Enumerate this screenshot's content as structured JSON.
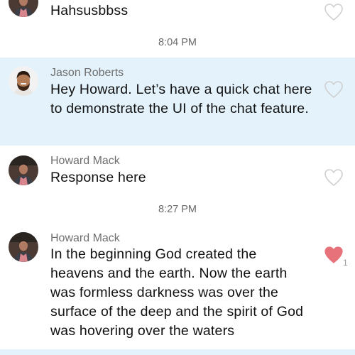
{
  "messages": [
    {
      "sender": "",
      "text": "Hahsusbbss",
      "liked": false,
      "avatar_icon": "howard-avatar",
      "highlighted": false
    },
    {
      "sender": "Jason Roberts",
      "text": "Hey Howard. Let’s have a quick chat here to demonstrate the UI of the chat feature.",
      "liked": false,
      "avatar_icon": "jason-avatar",
      "highlighted": true
    },
    {
      "sender": "Howard Mack",
      "text": "Response here",
      "liked": false,
      "avatar_icon": "howard-avatar",
      "highlighted": false
    },
    {
      "sender": "Howard Mack",
      "text": "In the beginning God created the heavens and the earth. Now the earth was formless darkness was over the surface of the deep and the spirit of God was hovering over the waters",
      "liked": true,
      "like_count": "1",
      "avatar_icon": "howard-avatar",
      "highlighted": false
    }
  ],
  "timestamps": [
    "8:04 PM",
    "8:27 PM"
  ],
  "colors": {
    "highlight_bg": "#e3f2fb",
    "heart_outline": "#cfcfcf",
    "heart_liked": "#e8727a",
    "sender_text": "#6f6f6f",
    "timestamp_text": "#6a6a6a"
  }
}
